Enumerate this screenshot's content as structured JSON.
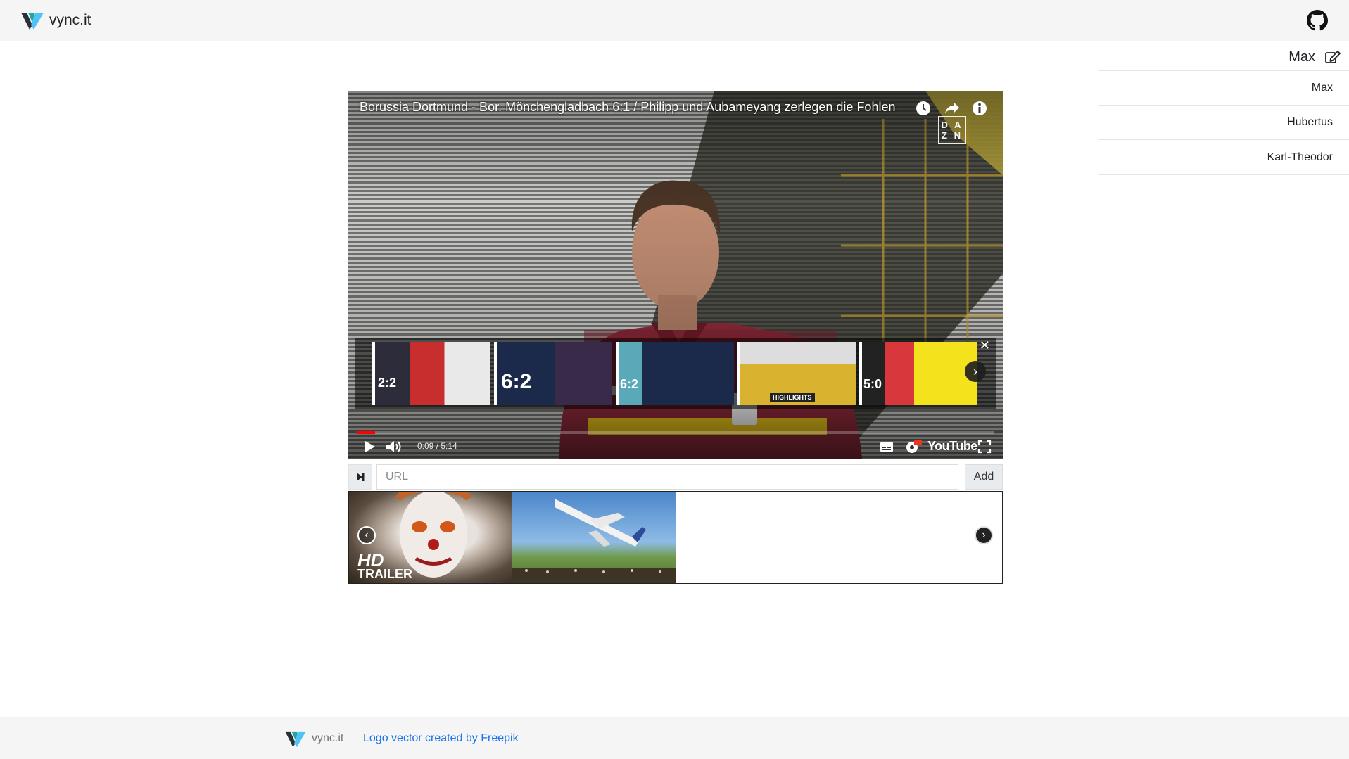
{
  "header": {
    "brand": "vync.it"
  },
  "user": {
    "current": "Max",
    "list": [
      "Max",
      "Hubertus",
      "Karl-Theodor"
    ]
  },
  "player": {
    "title": "Borussia Dortmund - Bor. Mönchengladbach 6:1 / Philipp und Aubameyang zerlegen die Fohlen",
    "channel_badge": "DAZN",
    "time": "0:09 / 5:14",
    "progress": 0.029,
    "youtube_label": "YouTube",
    "end_cards": [
      "2:2",
      "6:2",
      "6:2",
      "HIGHLIGHTS",
      "5:0"
    ]
  },
  "queue": {
    "url_placeholder": "URL",
    "add_label": "Add"
  },
  "playlist": {
    "items": [
      {
        "label_line1": "HD",
        "label_line2": "TRAILER"
      },
      {
        "label_line1": "",
        "label_line2": ""
      }
    ]
  },
  "footer": {
    "brand": "vync.it",
    "credit_link": "Logo vector created by Freepik"
  },
  "colors": {
    "accent_link": "#1a73e8",
    "progress": "#ff0000",
    "logo_dark": "#263238",
    "logo_light": "#4fc3f7"
  }
}
